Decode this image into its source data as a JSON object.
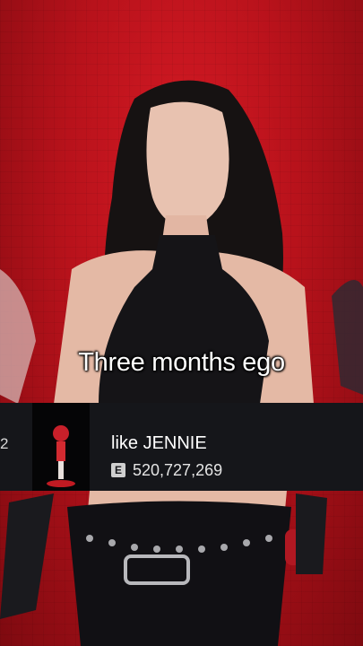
{
  "caption": "Three months ego",
  "music_card": {
    "rank": "2",
    "title": "like JENNIE",
    "explicit_badge": "E",
    "play_count": "520,727,269",
    "background_color": "#15161a"
  },
  "colors": {
    "stage_red": "#c8141e"
  }
}
